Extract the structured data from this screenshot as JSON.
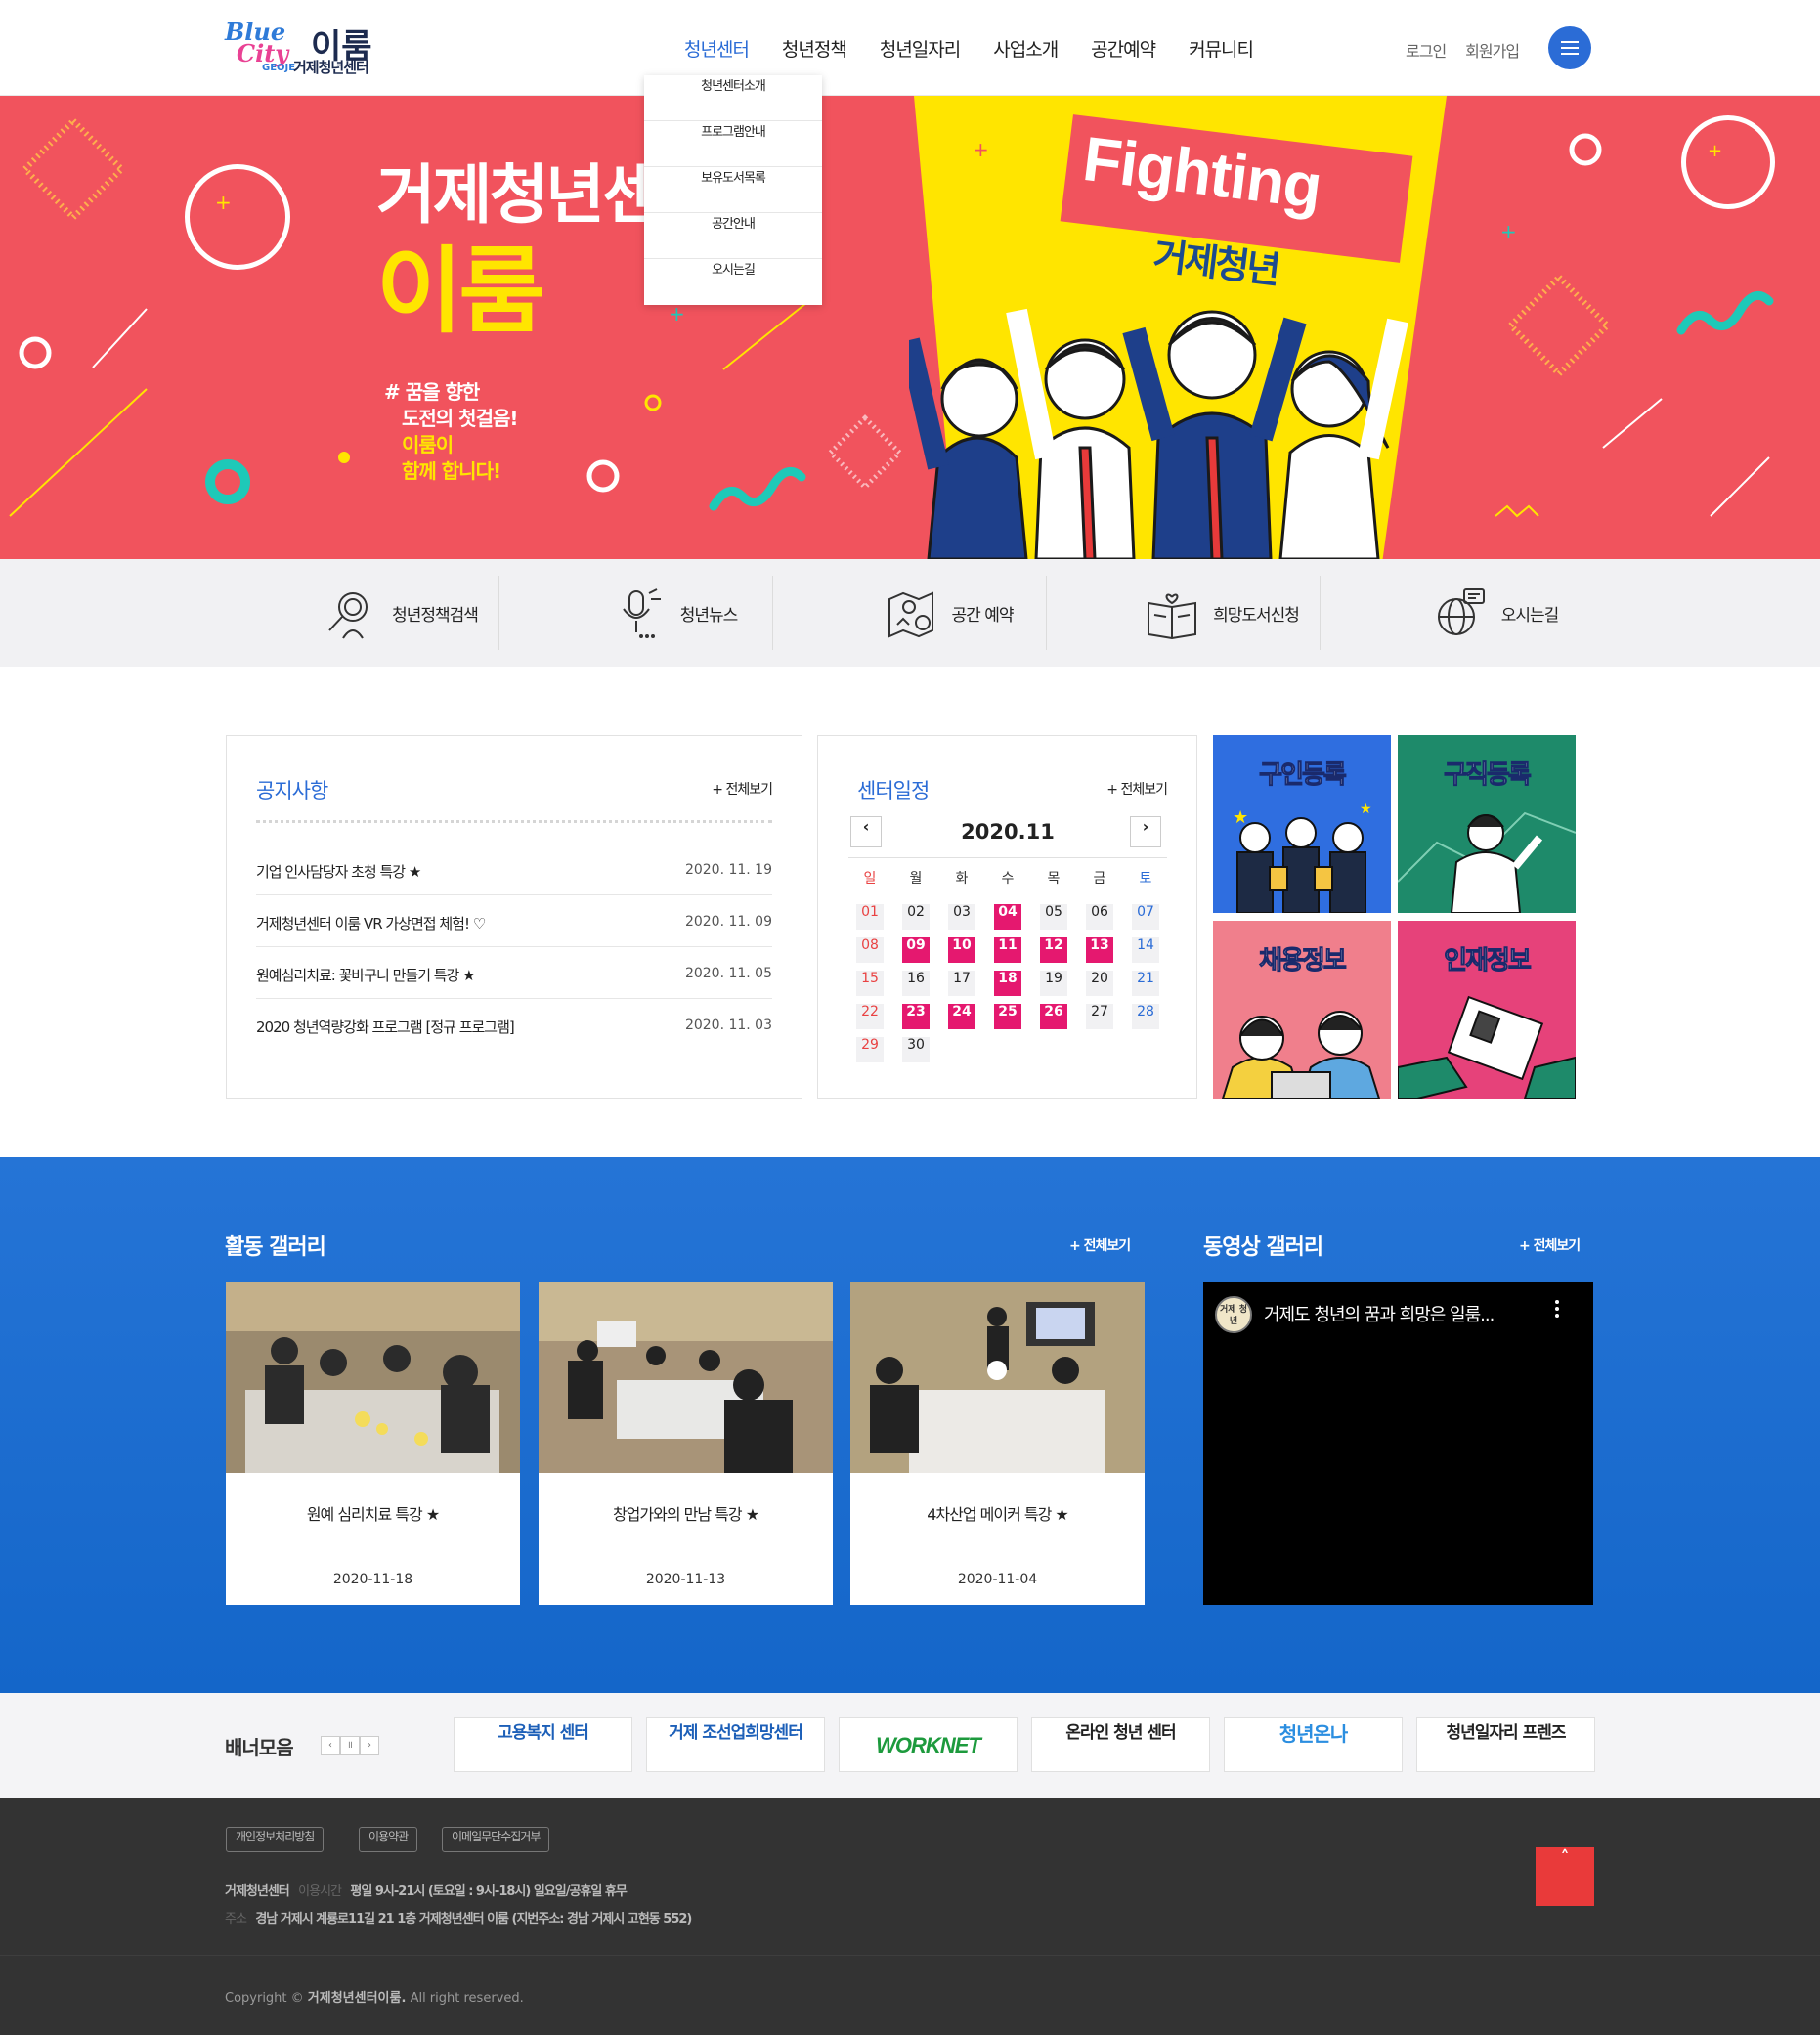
{
  "header": {
    "logo": {
      "line1": "Blue",
      "line2": "City",
      "place": "GEOJE",
      "name": "이룸",
      "sub": "거제청년센터"
    },
    "nav": [
      "청년센터",
      "청년정책",
      "청년일자리",
      "사업소개",
      "공간예약",
      "커뮤니티"
    ],
    "login": "로그인",
    "signup": "회원가입",
    "dropdown": [
      "청년센터소개",
      "프로그램안내",
      "보유도서목록",
      "공간안내",
      "오시는길"
    ]
  },
  "hero": {
    "title": "거제청년센터",
    "name": "이룸",
    "slogan1": "# 꿈을 향한",
    "slogan2": "도전의 첫걸음!",
    "slogan3": "이룸이",
    "slogan4": "함께 합니다!",
    "banner": "Fighting",
    "banner_sub": "거제청년",
    "slides": 4,
    "active_slide": 1
  },
  "quick": [
    {
      "label": "청년정책검색",
      "icon": "policy-search-icon"
    },
    {
      "label": "청년뉴스",
      "icon": "microphone-news-icon"
    },
    {
      "label": "공간 예약",
      "icon": "space-map-icon"
    },
    {
      "label": "희망도서신청",
      "icon": "book-icon"
    },
    {
      "label": "오시는길",
      "icon": "globe-chat-icon"
    }
  ],
  "notice": {
    "title": "공지사항",
    "more": "+ 전체보기",
    "items": [
      {
        "title": "기업 인사담당자 초청 특강 ★",
        "date": "2020. 11. 19"
      },
      {
        "title": "거제청년센터 이룸 VR 가상면접 체험! ♡",
        "date": "2020. 11. 09"
      },
      {
        "title": "원예심리치료: 꽃바구니 만들기 특강 ★",
        "date": "2020. 11. 05"
      },
      {
        "title": "2020 청년역량강화 프로그램 [정규 프로그램]",
        "date": "2020. 11. 03"
      }
    ]
  },
  "calendar": {
    "title": "센터일정",
    "more": "+ 전체보기",
    "month": "2020.11",
    "prev": "‹",
    "next": "›",
    "dow": [
      "일",
      "월",
      "화",
      "수",
      "목",
      "금",
      "토"
    ],
    "weeks": [
      [
        "01",
        "02",
        "03",
        "04",
        "05",
        "06",
        "07"
      ],
      [
        "08",
        "09",
        "10",
        "11",
        "12",
        "13",
        "14"
      ],
      [
        "15",
        "16",
        "17",
        "18",
        "19",
        "20",
        "21"
      ],
      [
        "22",
        "23",
        "24",
        "25",
        "26",
        "27",
        "28"
      ],
      [
        "29",
        "30"
      ]
    ],
    "event_days": [
      "04",
      "09",
      "10",
      "11",
      "12",
      "13",
      "18",
      "23",
      "24",
      "25",
      "26"
    ]
  },
  "cards": [
    {
      "label": "구인등록",
      "bg": "#2f6ee0"
    },
    {
      "label": "구직등록",
      "bg": "#1e8a6a"
    },
    {
      "label": "채용정보",
      "bg": "#f07f8c"
    },
    {
      "label": "인재정보",
      "bg": "#e6427a"
    }
  ],
  "gallery": {
    "title": "활동 갤러리",
    "more": "+ 전체보기",
    "items": [
      {
        "title": "원예 심리치료 특강 ★",
        "date": "2020-11-18"
      },
      {
        "title": "창업가와의 만남 특강 ★",
        "date": "2020-11-13"
      },
      {
        "title": "4차산업 메이커 특강 ★",
        "date": "2020-11-04"
      }
    ]
  },
  "video": {
    "title": "동영상 갤러리",
    "more": "+ 전체보기",
    "video_title": "거제도 청년의 꿈과 희망은 일룸...",
    "channel": "거제 청년"
  },
  "banners": {
    "title": "배너모음",
    "controls": [
      "‹",
      "॥",
      "›"
    ],
    "items": [
      "고용복지 센터",
      "거제 조선업희망센터",
      "WORKNET",
      "온라인 청년 센터",
      "청년온나",
      "청년일자리 프렌즈"
    ]
  },
  "footer": {
    "links": [
      "개인정보처리방침",
      "이용약관",
      "이메일무단수집거부"
    ],
    "org": "거제청년센터",
    "hours_label": "이용시간",
    "hours": "평일 9시-21시 (토요일 : 9시-18시) 일요일/공휴일 휴무",
    "addr_label": "주소",
    "addr": "경남 거제시 계룡로11길 21 1층 거제청년센터 이룸 (지번주소: 경남 거제시 고현동 552)",
    "copy_prefix": "Copyright ©",
    "copy_org": "거제청년센터이룸.",
    "copy_suffix": "All right reserved.",
    "top": "˄"
  },
  "colors": {
    "primary": "#2b6cd6",
    "hero": "#f1535d",
    "yellow": "#ffe500",
    "event": "#e5186f",
    "top_button": "#e93a3a"
  }
}
